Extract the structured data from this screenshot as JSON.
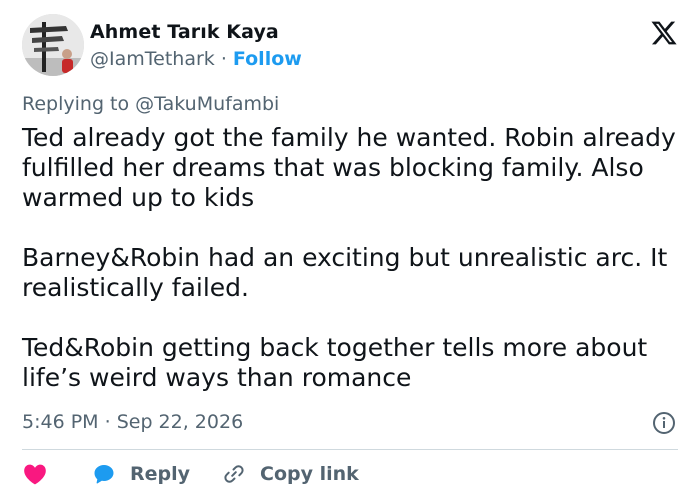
{
  "author": {
    "display_name": "Ahmet Tarık Kaya",
    "handle": "@IamTethark",
    "separator": "·",
    "follow_label": "Follow"
  },
  "reply_context": {
    "prefix": "Replying to ",
    "mention": "@TakuMufambi"
  },
  "tweet": {
    "paragraphs": [
      "Ted already got the family he wanted. Robin already fulfilled her dreams that was blocking family. Also warmed up to kids",
      "Barney&Robin had an exciting but unrealistic arc. It realistically failed.",
      "Ted&Robin getting back together tells more about life’s weird ways than romance"
    ],
    "time": "5:46 PM",
    "separator": "·",
    "date": "Sep 22, 2026"
  },
  "actions": {
    "reply_label": "Reply",
    "copy_link_label": "Copy link"
  },
  "colors": {
    "accent": "#1d9bf0",
    "like": "#f91880",
    "text": "#0f1419",
    "muted": "#536471",
    "divider": "#cfd9de"
  },
  "icons": [
    "x-logo-icon",
    "info-icon",
    "heart-icon",
    "reply-bubble-icon",
    "link-icon"
  ]
}
